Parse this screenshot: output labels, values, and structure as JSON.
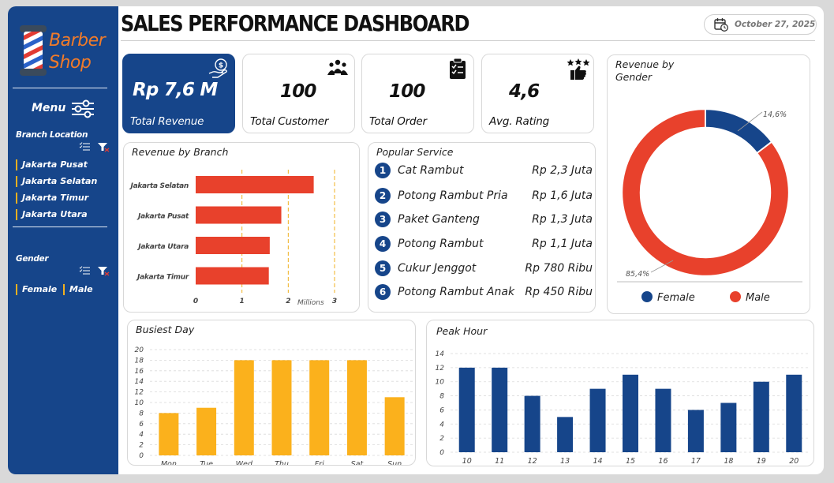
{
  "brand": {
    "line1": "Barber",
    "line2": "Shop"
  },
  "sidebar": {
    "menu_label": "Menu",
    "branch_heading": "Branch Location",
    "branches": [
      "Jakarta Pusat",
      "Jakarta Selatan",
      "Jakarta Timur",
      "Jakarta Utara"
    ],
    "gender_heading": "Gender",
    "genders": [
      "Female",
      "Male"
    ]
  },
  "header": {
    "title": "SALES PERFORMANCE DASHBOARD",
    "date": "October 27, 2025"
  },
  "kpis": {
    "revenue": {
      "value": "Rp 7,6 M",
      "label": "Total Revenue"
    },
    "customer": {
      "value": "100",
      "label": "Total Customer"
    },
    "order": {
      "value": "100",
      "label": "Total Order"
    },
    "rating": {
      "value": "4,6",
      "label": "Avg. Rating"
    }
  },
  "popular_service": {
    "title": "Popular Service",
    "items": [
      {
        "rank": "1",
        "name": "Cat Rambut",
        "value": "Rp 2,3 Juta"
      },
      {
        "rank": "2",
        "name": "Potong Rambut Pria",
        "value": "Rp 1,6 Juta"
      },
      {
        "rank": "3",
        "name": "Paket Ganteng",
        "value": "Rp 1,3 Juta"
      },
      {
        "rank": "4",
        "name": "Potong Rambut",
        "value": "Rp 1,1 Juta"
      },
      {
        "rank": "5",
        "name": "Cukur Jenggot",
        "value": "Rp 780 Ribu"
      },
      {
        "rank": "6",
        "name": "Potong Rambut Anak",
        "value": "Rp 450 Ribu"
      }
    ]
  },
  "colors": {
    "navy": "#16458a",
    "red": "#e8412c",
    "amber": "#fbb11c"
  },
  "chart_data": [
    {
      "id": "branch",
      "type": "bar",
      "orientation": "horizontal",
      "title": "Revenue by Branch",
      "categories": [
        "Jakarta Selatan",
        "Jakarta Pusat",
        "Jakarta Utara",
        "Jakarta Timur"
      ],
      "values": [
        2.55,
        1.85,
        1.6,
        1.58
      ],
      "unit_label": "Millions",
      "xlim": [
        0,
        3
      ],
      "xticks": [
        "0",
        "1",
        "2",
        "3"
      ],
      "gridlines": "dashed-vertical"
    },
    {
      "id": "gender",
      "type": "pie",
      "donut": true,
      "title": "Revenue by Gender",
      "labels": [
        "Female",
        "Male"
      ],
      "values": [
        14.6,
        85.4
      ],
      "data_labels": [
        "14,6%",
        "85,4%"
      ],
      "legend": "bottom"
    },
    {
      "id": "busiest_day",
      "type": "bar",
      "title": "Busiest Day",
      "categories": [
        "Mon",
        "Tue",
        "Wed",
        "Thu",
        "Fri",
        "Sat",
        "Sun"
      ],
      "values": [
        8,
        9,
        18,
        18,
        18,
        18,
        11
      ],
      "ylim": [
        0,
        20
      ],
      "yticks": [
        "0",
        "2",
        "4",
        "6",
        "8",
        "10",
        "12",
        "14",
        "16",
        "18",
        "20"
      ],
      "grid": true
    },
    {
      "id": "peak_hour",
      "type": "bar",
      "title": "Peak Hour",
      "categories": [
        "10",
        "11",
        "12",
        "13",
        "14",
        "15",
        "16",
        "17",
        "18",
        "19",
        "20"
      ],
      "values": [
        12,
        12,
        8,
        5,
        9,
        11,
        9,
        6,
        7,
        10,
        11
      ],
      "ylim": [
        0,
        14
      ],
      "yticks": [
        "0",
        "2",
        "4",
        "6",
        "8",
        "10",
        "12",
        "14"
      ],
      "grid": true
    }
  ]
}
